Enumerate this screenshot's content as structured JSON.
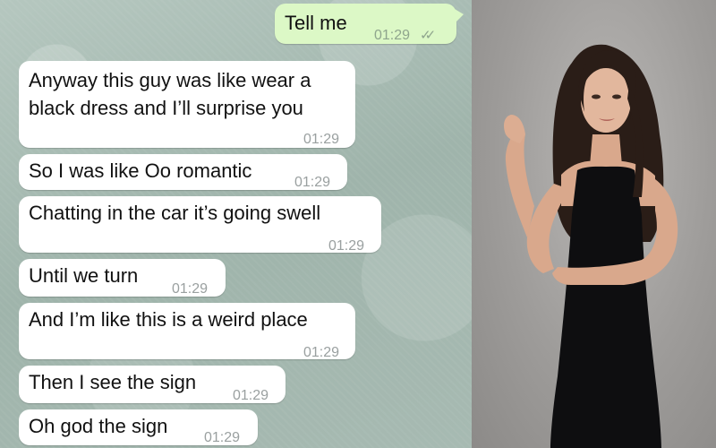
{
  "conversation": {
    "sent": [
      {
        "text": "Tell me",
        "time": "01:29",
        "status": "read"
      }
    ],
    "received": [
      {
        "lines": [
          "Anyway this guy was like wear a",
          "black dress and I’ll surprise you"
        ],
        "time": "01:29"
      },
      {
        "lines": [
          "So I was like Oo romantic"
        ],
        "time": "01:29"
      },
      {
        "lines": [
          "Chatting in the car it’s going swell"
        ],
        "time": "01:29"
      },
      {
        "lines": [
          "Until we turn"
        ],
        "time": "01:29"
      },
      {
        "lines": [
          "And I’m like this is a weird place"
        ],
        "time": "01:29"
      },
      {
        "lines": [
          "Then I see the sign"
        ],
        "time": "01:29"
      },
      {
        "lines": [
          "Oh god the sign"
        ],
        "time": "01:29"
      }
    ]
  },
  "colors": {
    "chat_background": "#a9bcb4",
    "incoming_bubble": "#ffffff",
    "outgoing_bubble": "#dcf8c6",
    "timestamp": "#9aa0a0"
  },
  "icons": {
    "read_receipt": "double-check-icon"
  }
}
